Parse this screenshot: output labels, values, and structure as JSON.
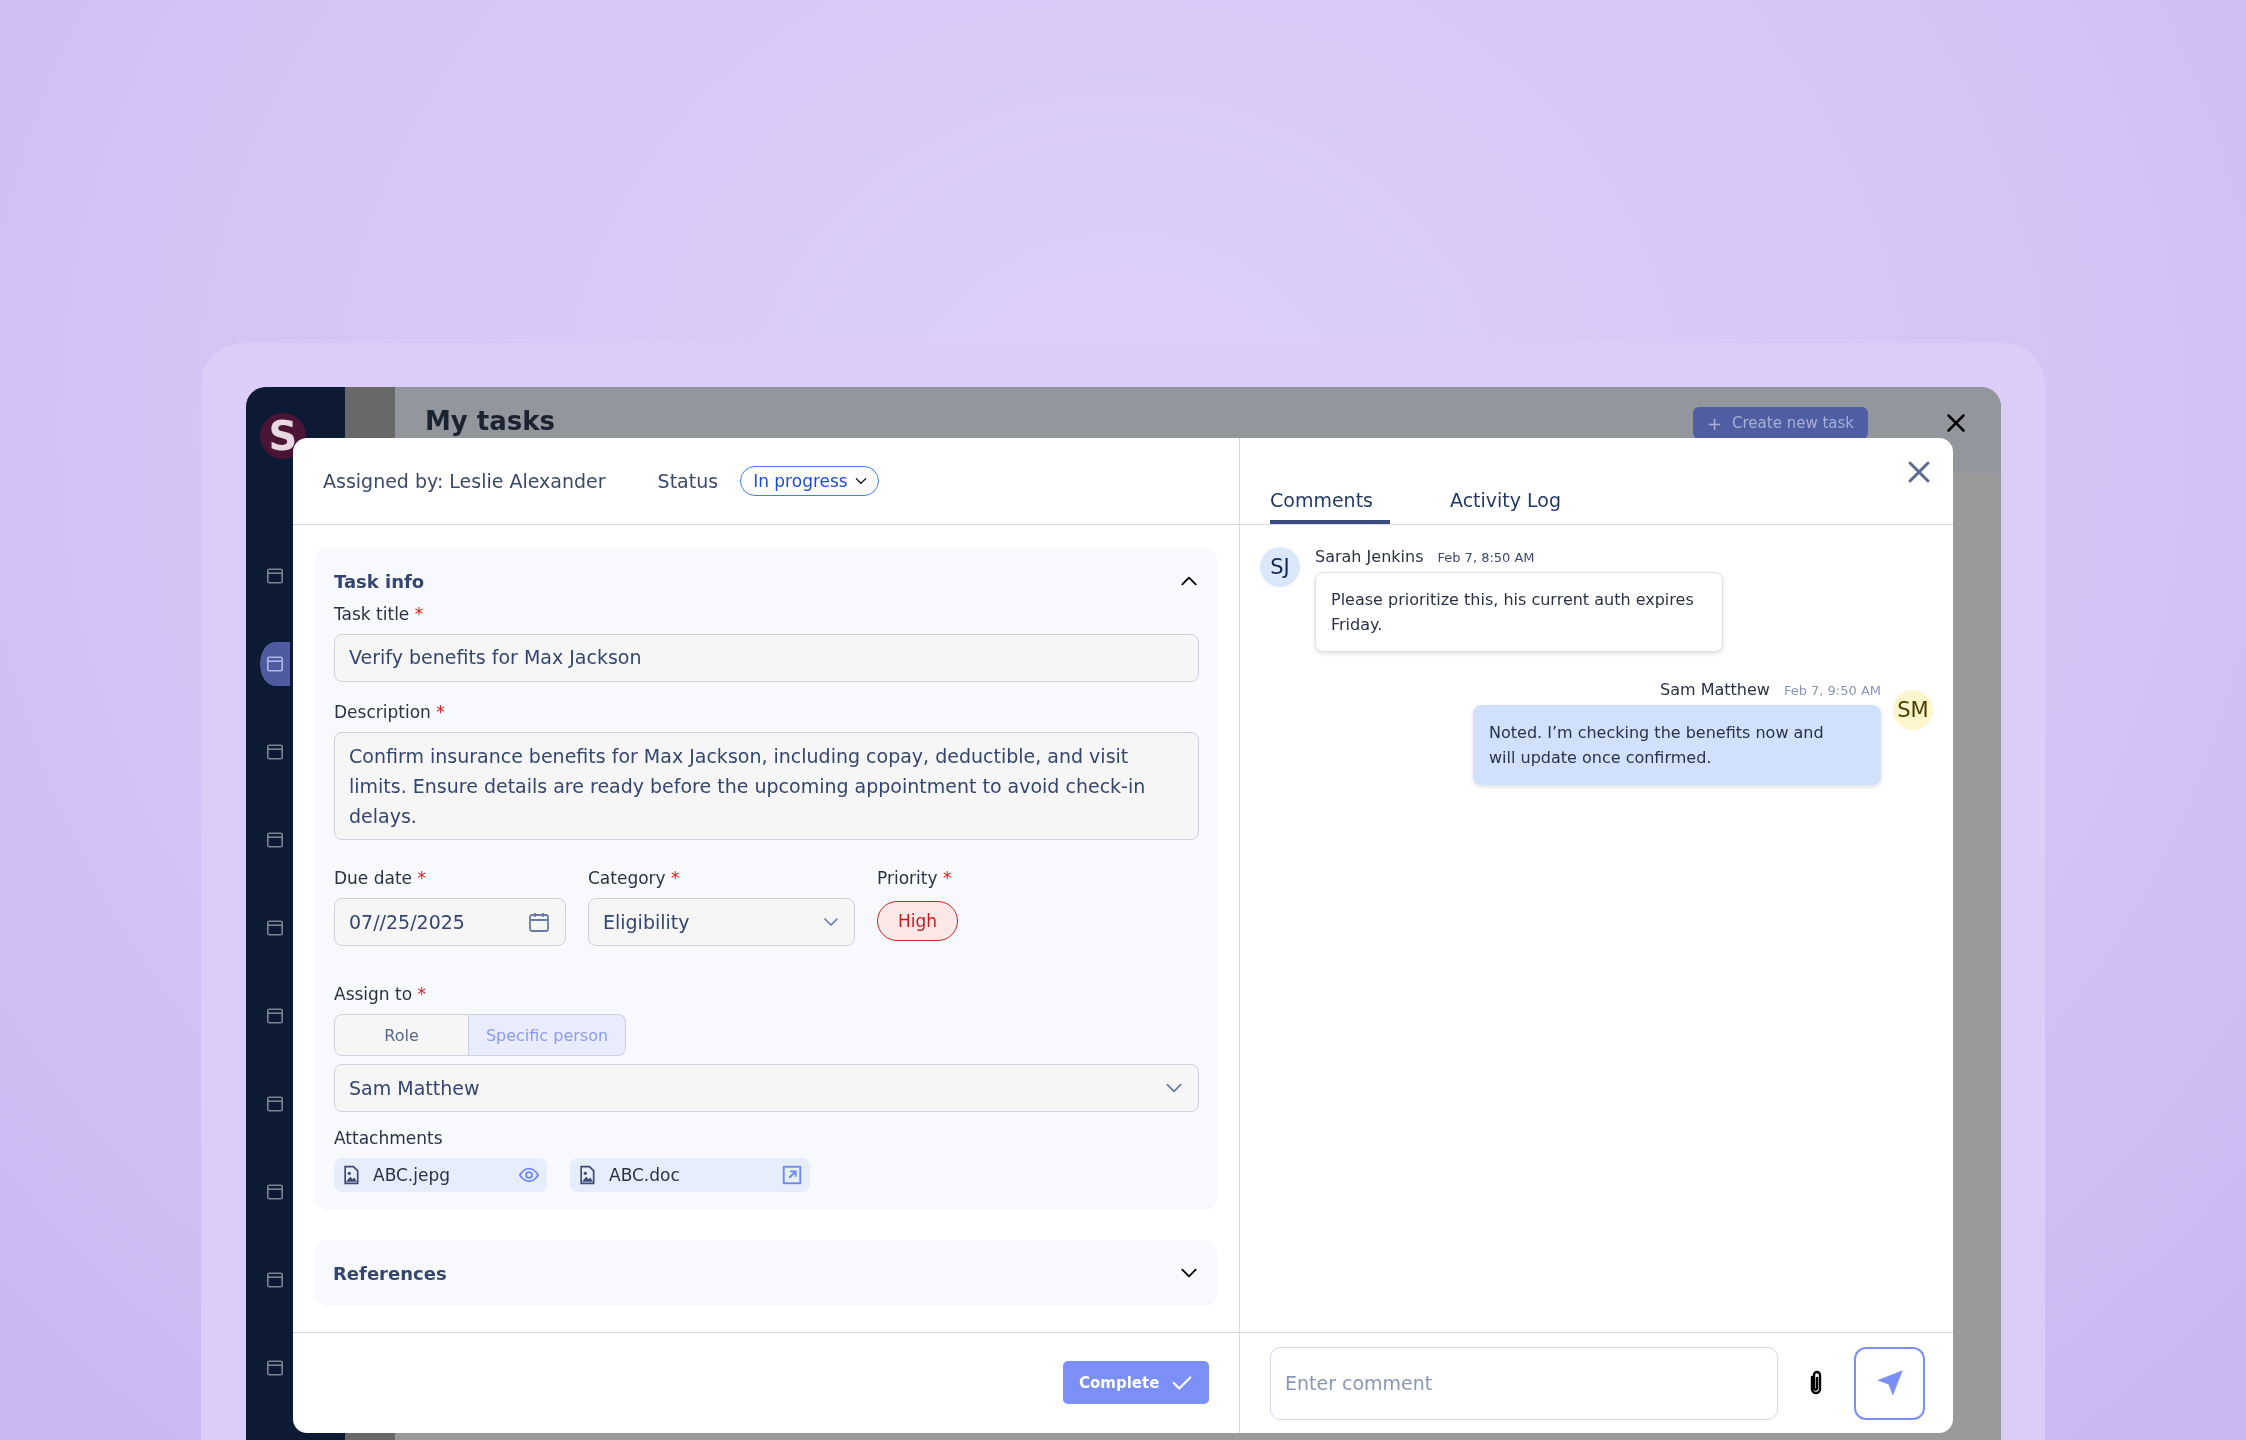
{
  "background_app": {
    "logo": "S",
    "page_title": "My tasks",
    "create_button": {
      "icon": "+",
      "label": "Create new task"
    },
    "sidebar_items": [
      {
        "selected": false
      },
      {
        "selected": true
      },
      {
        "selected": false
      },
      {
        "selected": false
      },
      {
        "selected": false
      },
      {
        "selected": false
      },
      {
        "selected": false
      },
      {
        "selected": false
      },
      {
        "selected": false
      },
      {
        "selected": false
      }
    ]
  },
  "task_panel": {
    "assigned_by": "Assigned by: Leslie Alexander",
    "status_label": "Status",
    "status": "In progress",
    "task_info": {
      "title": "Task info",
      "expanded": true,
      "task_title": {
        "label": "Task title",
        "marker": "*",
        "value": "Verify benefits for Max Jackson"
      },
      "description": {
        "label": "Description",
        "marker": "*",
        "value": "Confirm insurance benefits for Max Jackson, including copay, deductible, and visit limits. Ensure details are ready before the upcoming appointment to avoid check-in delays."
      },
      "due_date": {
        "label": "Due date",
        "marker": "*",
        "value": "07//25/2025"
      },
      "category": {
        "label": "Category",
        "marker": "*",
        "value": "Eligibility"
      },
      "priority": {
        "label": "Priority",
        "marker": "*",
        "value": "High"
      },
      "assign_to": {
        "label": "Assign to",
        "marker": "*",
        "options": [
          {
            "label": "Role",
            "selected": false
          },
          {
            "label": "Specific person",
            "selected": true
          }
        ],
        "value": "Sam Matthew"
      },
      "attachments": {
        "label": "Attachments",
        "files": [
          {
            "name": "ABC.jepg",
            "kind": "view"
          },
          {
            "name": "ABC.doc",
            "kind": "open"
          }
        ]
      }
    },
    "references": {
      "title": "References",
      "expanded": false
    },
    "complete_button": "Complete"
  },
  "comments_panel": {
    "tabs": [
      {
        "label": "Comments",
        "selected": true
      },
      {
        "label": "Activity Log",
        "selected": false
      }
    ],
    "comments": [
      {
        "initials": "SJ",
        "author": "Sarah Jenkins",
        "time": "Feb 7, 8:50 AM",
        "text": "Please prioritize this, his current auth expires Friday.",
        "own": false
      },
      {
        "initials": "SM",
        "author": "Sam Matthew",
        "time": "Feb 7, 9:50 AM",
        "text": "Noted. I’m checking the benefits now and will update once confirmed.",
        "own": true
      }
    ],
    "input": {
      "placeholder": "Enter comment"
    }
  }
}
